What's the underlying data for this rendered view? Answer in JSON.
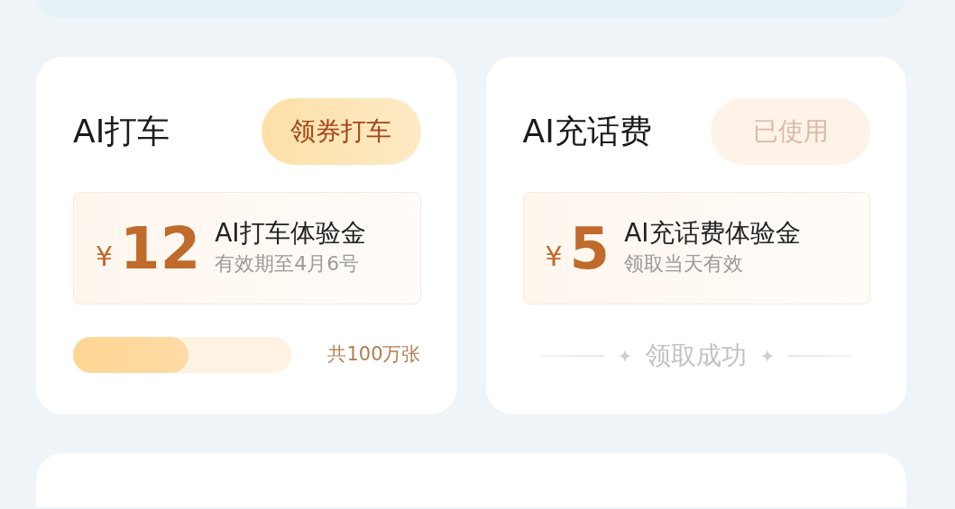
{
  "cards": [
    {
      "kind": "progress",
      "title": "AI打车",
      "button": {
        "label": "领券打车",
        "disabled": false
      },
      "coupon": {
        "currency": "¥",
        "amount": "12",
        "name": "AI打车体验金",
        "note": "有效期至4月6号"
      },
      "level": 0.53,
      "footer": "共100万张"
    },
    {
      "kind": "claimed",
      "title": "AI充话费",
      "button": {
        "label": "已使用",
        "disabled": true
      },
      "coupon": {
        "currency": "¥",
        "amount": "5",
        "name": "AI充话费体验金",
        "note": "领取当天有效"
      },
      "footer": "领取成功"
    }
  ]
}
